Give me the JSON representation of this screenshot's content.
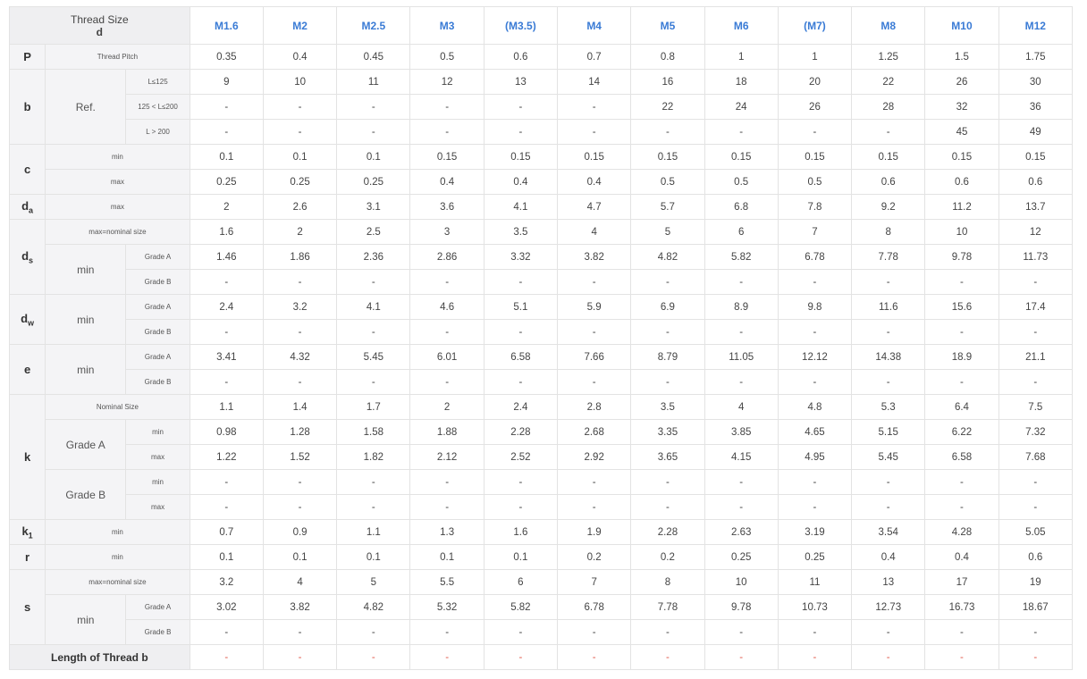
{
  "header": {
    "corner_line1": "Thread Size",
    "corner_line2": "d",
    "sizes": [
      "M1.6",
      "M2",
      "M2.5",
      "M3",
      "(M3.5)",
      "M4",
      "M5",
      "M6",
      "(M7)",
      "M8",
      "M10",
      "M12"
    ]
  },
  "labels": {
    "thread_pitch": "Thread Pitch",
    "ref": "Ref.",
    "l_le125": "L≤125",
    "l_125_200": "125 < L≤200",
    "l_gt200": "L > 200",
    "min": "min",
    "max": "max",
    "max_nominal": "max=nominal size",
    "grade_a": "Grade A",
    "grade_b": "Grade B",
    "nominal_size": "Nominal Size",
    "footer": "Length of Thread b"
  },
  "symbols": {
    "p": "P",
    "b": "b",
    "c": "c",
    "da": "d",
    "da_sub": "a",
    "ds": "d",
    "ds_sub": "s",
    "dw": "d",
    "dw_sub": "w",
    "e": "e",
    "k": "k",
    "k1": "k",
    "k1_sub": "1",
    "r": "r",
    "s": "s"
  },
  "rows": {
    "p": [
      "0.35",
      "0.4",
      "0.45",
      "0.5",
      "0.6",
      "0.7",
      "0.8",
      "1",
      "1",
      "1.25",
      "1.5",
      "1.75"
    ],
    "b1": [
      "9",
      "10",
      "11",
      "12",
      "13",
      "14",
      "16",
      "18",
      "20",
      "22",
      "26",
      "30"
    ],
    "b2": [
      "-",
      "-",
      "-",
      "-",
      "-",
      "-",
      "22",
      "24",
      "26",
      "28",
      "32",
      "36"
    ],
    "b3": [
      "-",
      "-",
      "-",
      "-",
      "-",
      "-",
      "-",
      "-",
      "-",
      "-",
      "45",
      "49"
    ],
    "c_min": [
      "0.1",
      "0.1",
      "0.1",
      "0.15",
      "0.15",
      "0.15",
      "0.15",
      "0.15",
      "0.15",
      "0.15",
      "0.15",
      "0.15"
    ],
    "c_max": [
      "0.25",
      "0.25",
      "0.25",
      "0.4",
      "0.4",
      "0.4",
      "0.5",
      "0.5",
      "0.5",
      "0.6",
      "0.6",
      "0.6"
    ],
    "da_max": [
      "2",
      "2.6",
      "3.1",
      "3.6",
      "4.1",
      "4.7",
      "5.7",
      "6.8",
      "7.8",
      "9.2",
      "11.2",
      "13.7"
    ],
    "ds_max": [
      "1.6",
      "2",
      "2.5",
      "3",
      "3.5",
      "4",
      "5",
      "6",
      "7",
      "8",
      "10",
      "12"
    ],
    "ds_a": [
      "1.46",
      "1.86",
      "2.36",
      "2.86",
      "3.32",
      "3.82",
      "4.82",
      "5.82",
      "6.78",
      "7.78",
      "9.78",
      "11.73"
    ],
    "ds_b": [
      "-",
      "-",
      "-",
      "-",
      "-",
      "-",
      "-",
      "-",
      "-",
      "-",
      "-",
      "-"
    ],
    "dw_a": [
      "2.4",
      "3.2",
      "4.1",
      "4.6",
      "5.1",
      "5.9",
      "6.9",
      "8.9",
      "9.8",
      "11.6",
      "15.6",
      "17.4"
    ],
    "dw_b": [
      "-",
      "-",
      "-",
      "-",
      "-",
      "-",
      "-",
      "-",
      "-",
      "-",
      "-",
      "-"
    ],
    "e_a": [
      "3.41",
      "4.32",
      "5.45",
      "6.01",
      "6.58",
      "7.66",
      "8.79",
      "11.05",
      "12.12",
      "14.38",
      "18.9",
      "21.1"
    ],
    "e_b": [
      "-",
      "-",
      "-",
      "-",
      "-",
      "-",
      "-",
      "-",
      "-",
      "-",
      "-",
      "-"
    ],
    "k_nom": [
      "1.1",
      "1.4",
      "1.7",
      "2",
      "2.4",
      "2.8",
      "3.5",
      "4",
      "4.8",
      "5.3",
      "6.4",
      "7.5"
    ],
    "k_a_min": [
      "0.98",
      "1.28",
      "1.58",
      "1.88",
      "2.28",
      "2.68",
      "3.35",
      "3.85",
      "4.65",
      "5.15",
      "6.22",
      "7.32"
    ],
    "k_a_max": [
      "1.22",
      "1.52",
      "1.82",
      "2.12",
      "2.52",
      "2.92",
      "3.65",
      "4.15",
      "4.95",
      "5.45",
      "6.58",
      "7.68"
    ],
    "k_b_min": [
      "-",
      "-",
      "-",
      "-",
      "-",
      "-",
      "-",
      "-",
      "-",
      "-",
      "-",
      "-"
    ],
    "k_b_max": [
      "-",
      "-",
      "-",
      "-",
      "-",
      "-",
      "-",
      "-",
      "-",
      "-",
      "-",
      "-"
    ],
    "k1_min": [
      "0.7",
      "0.9",
      "1.1",
      "1.3",
      "1.6",
      "1.9",
      "2.28",
      "2.63",
      "3.19",
      "3.54",
      "4.28",
      "5.05"
    ],
    "r_min": [
      "0.1",
      "0.1",
      "0.1",
      "0.1",
      "0.1",
      "0.2",
      "0.2",
      "0.25",
      "0.25",
      "0.4",
      "0.4",
      "0.6"
    ],
    "s_max": [
      "3.2",
      "4",
      "5",
      "5.5",
      "6",
      "7",
      "8",
      "10",
      "11",
      "13",
      "17",
      "19"
    ],
    "s_a": [
      "3.02",
      "3.82",
      "4.82",
      "5.32",
      "5.82",
      "6.78",
      "7.78",
      "9.78",
      "10.73",
      "12.73",
      "16.73",
      "18.67"
    ],
    "s_b": [
      "-",
      "-",
      "-",
      "-",
      "-",
      "-",
      "-",
      "-",
      "-",
      "-",
      "-",
      "-"
    ],
    "footer": [
      "-",
      "-",
      "-",
      "-",
      "-",
      "-",
      "-",
      "-",
      "-",
      "-",
      "-",
      "-"
    ]
  },
  "colors": {
    "accent": "#3a7bd5",
    "footer_dash": "#e05a4a",
    "label_bg": "#f4f4f6"
  }
}
